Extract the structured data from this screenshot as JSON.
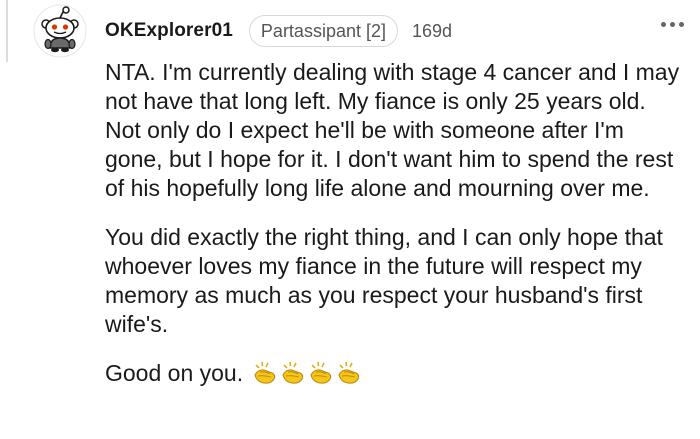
{
  "comment": {
    "username": "OKExplorer01",
    "flair": "Partassipant [2]",
    "age": "169d",
    "paragraphs": [
      "NTA. I'm currently dealing with stage 4 cancer and I may not have that long left. My fiance is only 25 years old. Not only do I expect he'll be with someone after I'm gone, but I hope for it. I don't want him to spend the rest of his hopefully long life alone and mourning over me.",
      "You did exactly the right thing, and I can only hope that whoever loves my fiance in the future will respect my memory as much as you respect your husband's first wife's.",
      "Good on you."
    ],
    "emoji": [
      "clapping-hands-icon",
      "clapping-hands-icon",
      "clapping-hands-icon",
      "clapping-hands-icon"
    ],
    "more_icon": "more-options-icon",
    "avatar_icon": "snoo-avatar-icon"
  },
  "colors": {
    "text": "#1a1a1b",
    "meta": "#555555",
    "flair_border": "#d8d8d8",
    "emoji": "#f5c518"
  }
}
